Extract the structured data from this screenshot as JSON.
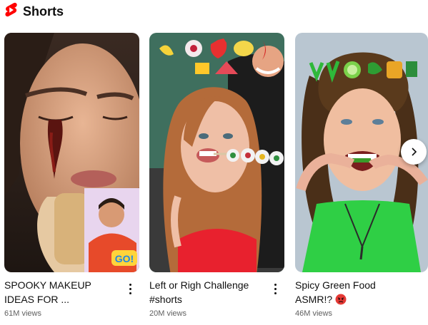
{
  "section": {
    "title": "Shorts",
    "brand_color": "#ff0000"
  },
  "videos": [
    {
      "title": "SPOOKY MAKEUP\nIDEAS FOR ...",
      "views": "61M views",
      "overlay_text": "GO!"
    },
    {
      "title": "Left or Righ Challenge\n#shorts",
      "views": "20M views"
    },
    {
      "title": "Spicy Green Food\nASMR!?",
      "views": "46M views",
      "title_emoji": "angry-face-emoji"
    }
  ],
  "controls": {
    "next_icon": "chevron-right-icon",
    "more_icon": "more-vertical-icon"
  }
}
